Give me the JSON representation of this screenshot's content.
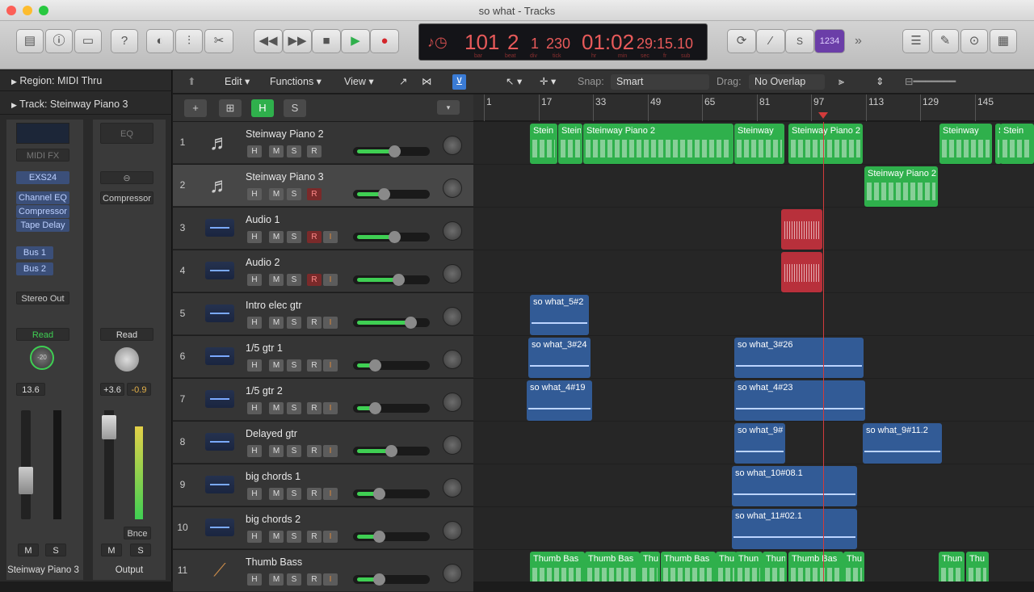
{
  "window": {
    "title": "so what - Tracks"
  },
  "toolbar": {
    "icons": [
      "library-icon",
      "info-icon",
      "editors-icon",
      "help-icon",
      "smart-controls-icon",
      "mixer-icon",
      "scissors-icon"
    ],
    "lcd": {
      "bar": "101",
      "beat": "2",
      "div": "1",
      "tick": "230",
      "time": "01:02",
      "subtime": "29:15.10",
      "labels": {
        "bar": "bar",
        "beat": "beat",
        "div": "div",
        "tick": "tick",
        "hr": "hr",
        "min": "min",
        "sec": "sec",
        "fr": "fr",
        "sub": "sub"
      }
    },
    "right_icons": [
      "cycle-icon",
      "tuning-icon",
      "solo-icon",
      "count-in-icon"
    ],
    "count_in": "1234"
  },
  "inspector": {
    "region": "Region: MIDI Thru",
    "track": "Track: Steinway Piano 3",
    "left_channel": {
      "eq": "",
      "midi_fx": "MIDI FX",
      "instrument": "EXS24",
      "plugins": [
        "Channel EQ",
        "Compressor",
        "Tape Delay"
      ],
      "sends": [
        "Bus 1",
        "Bus 2"
      ],
      "output": "Stereo Out",
      "automation": "Read",
      "pan_value": "-20",
      "volume": "13.6",
      "mute": "M",
      "solo": "S",
      "name": "Steinway Piano 3"
    },
    "right_channel": {
      "eq": "EQ",
      "plugins": [
        "Compressor"
      ],
      "automation": "Read",
      "volume": "+3.6",
      "peak": "-0.9",
      "bounce": "Bnce",
      "mute": "M",
      "solo": "S",
      "name": "Output"
    }
  },
  "edit_header": {
    "edit": "Edit",
    "functions": "Functions",
    "view": "View",
    "snap_label": "Snap:",
    "snap_value": "Smart",
    "drag_label": "Drag:",
    "drag_value": "No Overlap"
  },
  "track_header": {
    "add": "+",
    "h": "H",
    "s": "S"
  },
  "tracks": [
    {
      "num": "1",
      "name": "Steinway Piano 2",
      "type": "piano",
      "volume": 0.52,
      "record": false
    },
    {
      "num": "2",
      "name": "Steinway Piano 3",
      "type": "piano",
      "volume": 0.35,
      "record": true,
      "selected": true
    },
    {
      "num": "3",
      "name": "Audio 1",
      "type": "audio",
      "volume": 0.52,
      "record": true,
      "input": true
    },
    {
      "num": "4",
      "name": "Audio 2",
      "type": "audio",
      "volume": 0.58,
      "record": true,
      "input": true
    },
    {
      "num": "5",
      "name": "Intro elec gtr",
      "type": "audio",
      "volume": 0.78,
      "input": true
    },
    {
      "num": "6",
      "name": "1/5 gtr 1",
      "type": "audio",
      "volume": 0.2,
      "input": true
    },
    {
      "num": "7",
      "name": "1/5 gtr 2",
      "type": "audio",
      "volume": 0.2,
      "input": true
    },
    {
      "num": "8",
      "name": "Delayed gtr",
      "type": "audio",
      "volume": 0.47,
      "input": true
    },
    {
      "num": "9",
      "name": "big chords 1",
      "type": "audio",
      "volume": 0.27,
      "input": true
    },
    {
      "num": "10",
      "name": "big chords 2",
      "type": "audio",
      "volume": 0.27,
      "input": true
    },
    {
      "num": "11",
      "name": "Thumb Bass",
      "type": "bass",
      "volume": 0.27,
      "input": true
    }
  ],
  "mute_labels": {
    "h": "H",
    "m": "M",
    "s": "S",
    "r": "R",
    "i": "I"
  },
  "ruler": [
    "1",
    "17",
    "33",
    "49",
    "65",
    "81",
    "97",
    "113",
    "129",
    "145"
  ],
  "regions": [
    {
      "lane": 0,
      "kind": "midi",
      "label": "Stein"
    },
    {
      "lane": 0,
      "kind": "midi",
      "label": "Stein"
    },
    {
      "lane": 0,
      "kind": "midi",
      "label": "Steinway Piano 2"
    },
    {
      "lane": 0,
      "kind": "midi",
      "label": "Steinway"
    },
    {
      "lane": 0,
      "kind": "midi",
      "label": "Steinway Piano 2"
    },
    {
      "lane": 0,
      "kind": "midi",
      "label": "Steinway"
    },
    {
      "lane": 0,
      "kind": "midi",
      "label": "S"
    },
    {
      "lane": 0,
      "kind": "midi",
      "label": "Stein"
    },
    {
      "lane": 1,
      "kind": "midi",
      "label": "Steinway Piano 2"
    },
    {
      "lane": 2,
      "kind": "red",
      "label": ""
    },
    {
      "lane": 3,
      "kind": "red",
      "label": ""
    },
    {
      "lane": 4,
      "kind": "aud",
      "label": "so what_5#2"
    },
    {
      "lane": 5,
      "kind": "aud",
      "label": "so what_3#24"
    },
    {
      "lane": 5,
      "kind": "aud",
      "label": "so what_3#26"
    },
    {
      "lane": 6,
      "kind": "aud",
      "label": "so what_4#19"
    },
    {
      "lane": 6,
      "kind": "aud",
      "label": "so what_4#23"
    },
    {
      "lane": 7,
      "kind": "aud",
      "label": "so what_9#"
    },
    {
      "lane": 7,
      "kind": "aud",
      "label": "so what_9#11.2"
    },
    {
      "lane": 8,
      "kind": "aud",
      "label": "so what_10#08.1"
    },
    {
      "lane": 9,
      "kind": "aud",
      "label": "so what_11#02.1"
    },
    {
      "lane": 10,
      "kind": "midi",
      "label": "Thumb Bas"
    },
    {
      "lane": 10,
      "kind": "midi",
      "label": "Thumb Bas"
    },
    {
      "lane": 10,
      "kind": "midi",
      "label": "Thu"
    },
    {
      "lane": 10,
      "kind": "midi",
      "label": "Thumb Bas"
    },
    {
      "lane": 10,
      "kind": "midi",
      "label": "Thu"
    },
    {
      "lane": 10,
      "kind": "midi",
      "label": "Thun"
    },
    {
      "lane": 10,
      "kind": "midi",
      "label": "Thun"
    },
    {
      "lane": 10,
      "kind": "midi",
      "label": "Thumb Bas"
    },
    {
      "lane": 10,
      "kind": "midi",
      "label": "Thu"
    },
    {
      "lane": 10,
      "kind": "midi",
      "label": "Thun"
    },
    {
      "lane": 10,
      "kind": "midi",
      "label": "Thu"
    }
  ],
  "colors": {
    "midi": "#2fb04c",
    "audio": "#325b96",
    "record": "#b8303b",
    "playhead": "#d23b3b",
    "lcd": "#e85a5a"
  }
}
